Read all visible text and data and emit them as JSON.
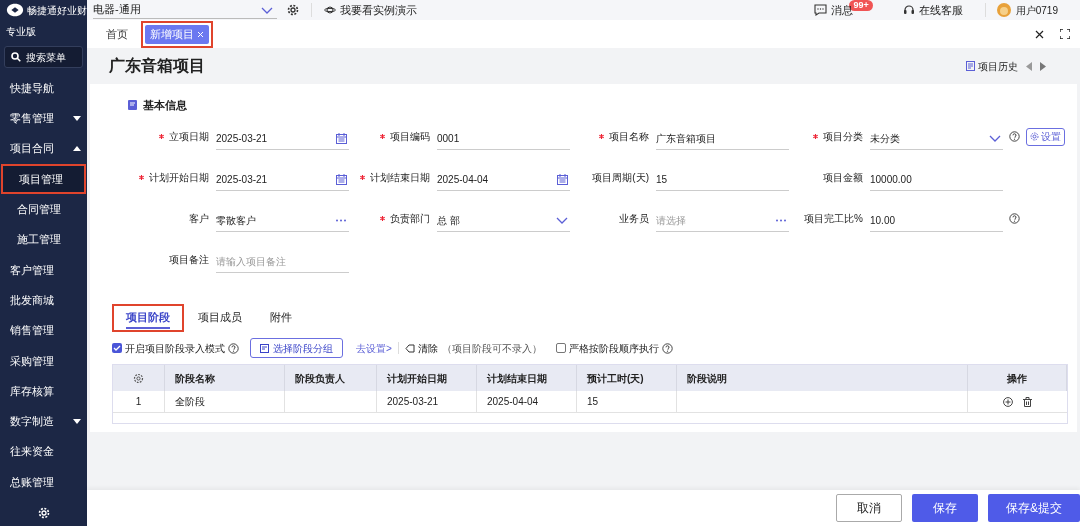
{
  "brand": {
    "name": "畅捷通好业财",
    "edition": "专业版"
  },
  "sidebar": {
    "search": "搜索菜单",
    "items": [
      {
        "label": "快捷导航",
        "kind": "plain",
        "selected": false,
        "highlighted": false
      },
      {
        "label": "零售管理",
        "kind": "group",
        "expanded": false,
        "selected": false,
        "highlighted": false
      },
      {
        "label": "项目合同",
        "kind": "group",
        "expanded": true,
        "selected": false,
        "highlighted": false,
        "children": [
          {
            "label": "项目管理",
            "selected": true,
            "highlighted": true
          },
          {
            "label": "合同管理",
            "selected": false,
            "highlighted": false
          },
          {
            "label": "施工管理",
            "selected": false,
            "highlighted": false
          }
        ]
      },
      {
        "label": "客户管理",
        "kind": "plain",
        "selected": false,
        "highlighted": false
      },
      {
        "label": "批发商城",
        "kind": "plain",
        "selected": false,
        "highlighted": false
      },
      {
        "label": "销售管理",
        "kind": "plain",
        "selected": false,
        "highlighted": false
      },
      {
        "label": "采购管理",
        "kind": "plain",
        "selected": false,
        "highlighted": false
      },
      {
        "label": "库存核算",
        "kind": "plain",
        "selected": false,
        "highlighted": false
      },
      {
        "label": "数字制造",
        "kind": "group",
        "expanded": false,
        "selected": false,
        "highlighted": false
      },
      {
        "label": "往来资金",
        "kind": "plain",
        "selected": false,
        "highlighted": false
      },
      {
        "label": "总账管理",
        "kind": "plain",
        "selected": false,
        "highlighted": false
      }
    ]
  },
  "top_bar": {
    "company": "电器-通用",
    "demo": "我要看实例演示",
    "messages": "消息",
    "message_badge": "99+",
    "support": "在线客服",
    "user": "用户0719"
  },
  "tabs": [
    {
      "label": "首页",
      "selected": false,
      "highlighted": false,
      "closable": false
    },
    {
      "label": "新增项目",
      "selected": true,
      "highlighted": true,
      "closable": true
    }
  ],
  "page": {
    "title": "广东音箱项目",
    "history": "项目历史"
  },
  "section": {
    "title": "基本信息"
  },
  "fields": [
    {
      "label": "立项日期",
      "required": true,
      "kind": "date",
      "value": "2025-03-21"
    },
    {
      "label": "项目编码",
      "required": true,
      "kind": "text",
      "value": "0001"
    },
    {
      "label": "项目名称",
      "required": true,
      "kind": "text",
      "value": "广东音箱项目"
    },
    {
      "label": "项目分类",
      "required": true,
      "kind": "select",
      "value": "未分类",
      "help": true,
      "button": "设置"
    },
    {
      "label": "计划开始日期",
      "required": true,
      "kind": "date",
      "value": "2025-03-21"
    },
    {
      "label": "计划结束日期",
      "required": true,
      "kind": "date",
      "value": "2025-04-04"
    },
    {
      "label": "项目周期(天)",
      "required": false,
      "kind": "text",
      "value": "15"
    },
    {
      "label": "项目金额",
      "required": false,
      "kind": "text",
      "value": "10000.00"
    },
    {
      "label": "客户",
      "required": false,
      "kind": "lookup",
      "value": "零散客户"
    },
    {
      "label": "负责部门",
      "required": true,
      "kind": "select",
      "value": "总 部"
    },
    {
      "label": "业务员",
      "required": false,
      "kind": "lookup",
      "placeholder": "请选择"
    },
    {
      "label": "项目完工比%",
      "required": false,
      "kind": "text",
      "value": "10.00",
      "help": true
    },
    {
      "label": "项目备注",
      "required": false,
      "kind": "text",
      "placeholder": "请输入项目备注"
    }
  ],
  "detail_tabs": [
    {
      "label": "项目阶段",
      "selected": true,
      "highlighted": true
    },
    {
      "label": "项目成员",
      "selected": false,
      "highlighted": false
    },
    {
      "label": "附件",
      "selected": false,
      "highlighted": false
    }
  ],
  "toolbar": {
    "stage_mode": {
      "label": "开启项目阶段录入模式",
      "checked": true
    },
    "choose_group": "选择阶段分组",
    "settings_link": "去设置>",
    "clear": "清除",
    "note": "（项目阶段可不录入）",
    "strict_order": {
      "label": "严格按阶段顺序执行",
      "checked": false
    }
  },
  "table": {
    "columns": [
      "阶段名称",
      "阶段负责人",
      "计划开始日期",
      "计划结束日期",
      "预计工时(天)",
      "阶段说明",
      "操作"
    ],
    "rows": [
      {
        "index": "1",
        "cells": [
          "全阶段",
          "",
          "2025-03-21",
          "2025-04-04",
          "15",
          ""
        ]
      }
    ]
  },
  "footer": {
    "buttons": [
      {
        "label": "取消",
        "kind": "secondary"
      },
      {
        "label": "保存",
        "kind": "primary"
      },
      {
        "label": "保存&提交",
        "kind": "primary"
      }
    ]
  }
}
